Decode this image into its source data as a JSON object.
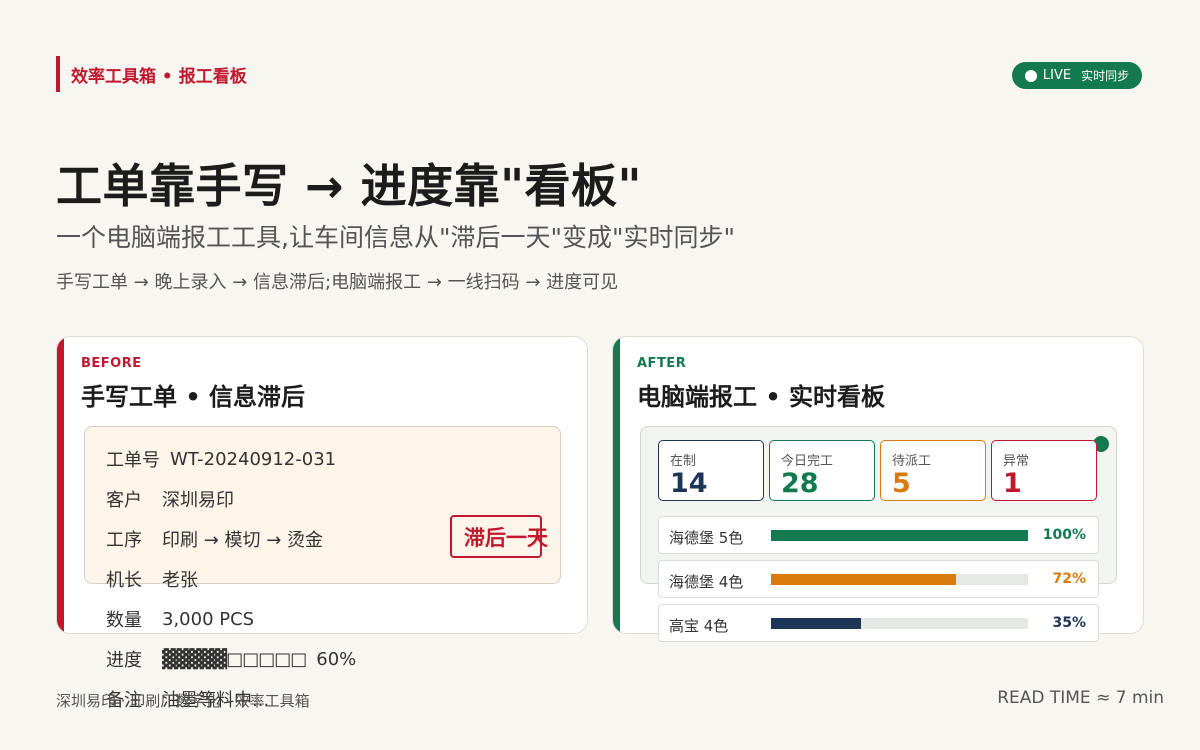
{
  "brand": "效率工具箱 • 报工看板",
  "live": {
    "label": "LIVE",
    "sub": "实时同步"
  },
  "headline": "工单靠手写 → 进度靠\"看板\"",
  "subline": "一个电脑端报工工具,让车间信息从\"滞后一天\"变成\"实时同步\"",
  "flow": "手写工单 → 晚上录入 → 信息滞后;电脑端报工 → 一线扫码 → 进度可见",
  "before": {
    "tag": "BEFORE",
    "title": "手写工单 • 信息滞后",
    "rows": [
      {
        "label": "工单号",
        "value": "WT-20240912-031"
      },
      {
        "label": "客户",
        "value": "深圳易印"
      },
      {
        "label": "工序",
        "value": "印刷 → 模切 → 烫金"
      },
      {
        "label": "机长",
        "value": "老张"
      },
      {
        "label": "数量",
        "value": "3,000 PCS"
      },
      {
        "label": "进度",
        "bar": "▓▓▓▓▓□□□□□",
        "value": "60%",
        "progress": 0.6
      },
      {
        "label": "备注",
        "value": "油墨等料中..."
      }
    ],
    "stamp": "滞后一天"
  },
  "after": {
    "tag": "AFTER",
    "title": "电脑端报工 • 实时看板",
    "stats": [
      {
        "label": "在制",
        "value": "14",
        "color": "#1d3557"
      },
      {
        "label": "今日完工",
        "value": "28",
        "color": "#137a4f"
      },
      {
        "label": "待派工",
        "value": "5",
        "color": "#d97a0c"
      },
      {
        "label": "异常",
        "value": "1",
        "color": "#c0182f"
      }
    ],
    "machines": [
      {
        "name": "海德堡 5色",
        "progress": 1.0,
        "pct": "100%",
        "color": "#137a4f"
      },
      {
        "name": "海德堡 4色",
        "progress": 0.72,
        "pct": "72%",
        "color": "#d97a0c"
      },
      {
        "name": "高宝 4色",
        "progress": 0.35,
        "pct": "35%",
        "color": "#1d3557"
      }
    ]
  },
  "footer": {
    "left": "深圳易印 · 印刷厂数字化 · 效率工具箱",
    "right": "READ TIME ≈ 7 min"
  }
}
